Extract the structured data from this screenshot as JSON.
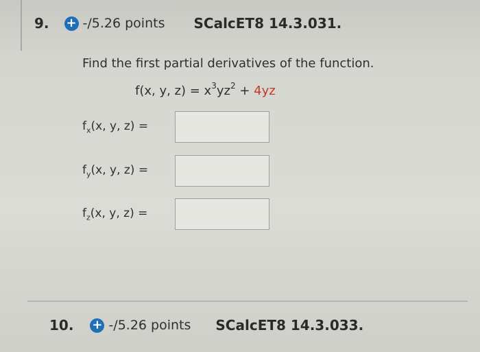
{
  "question9": {
    "number": "9.",
    "points": "-/5.26 points",
    "id": "SCalcET8 14.3.031."
  },
  "prompt": "Find the first partial derivatives of the function.",
  "function": {
    "prefix": "f(x, y, z) = x",
    "exp1": "3",
    "mid": "yz",
    "exp2": "2",
    "plus": " + ",
    "term": "4yz"
  },
  "answers": [
    {
      "fn": "f",
      "sub": "x",
      "args": "(x, y, z)  =",
      "value": ""
    },
    {
      "fn": "f",
      "sub": "y",
      "args": "(x, y, z)  =",
      "value": ""
    },
    {
      "fn": "f",
      "sub": "z",
      "args": "(x, y, z)  =",
      "value": ""
    }
  ],
  "question10": {
    "number": "10.",
    "points": "-/5.26 points",
    "id": "SCalcET8 14.3.033."
  },
  "colors": {
    "plus_icon": "#1f6fb8",
    "highlight": "#c0392b"
  },
  "icons": {
    "expand": "plus-circle-icon"
  }
}
